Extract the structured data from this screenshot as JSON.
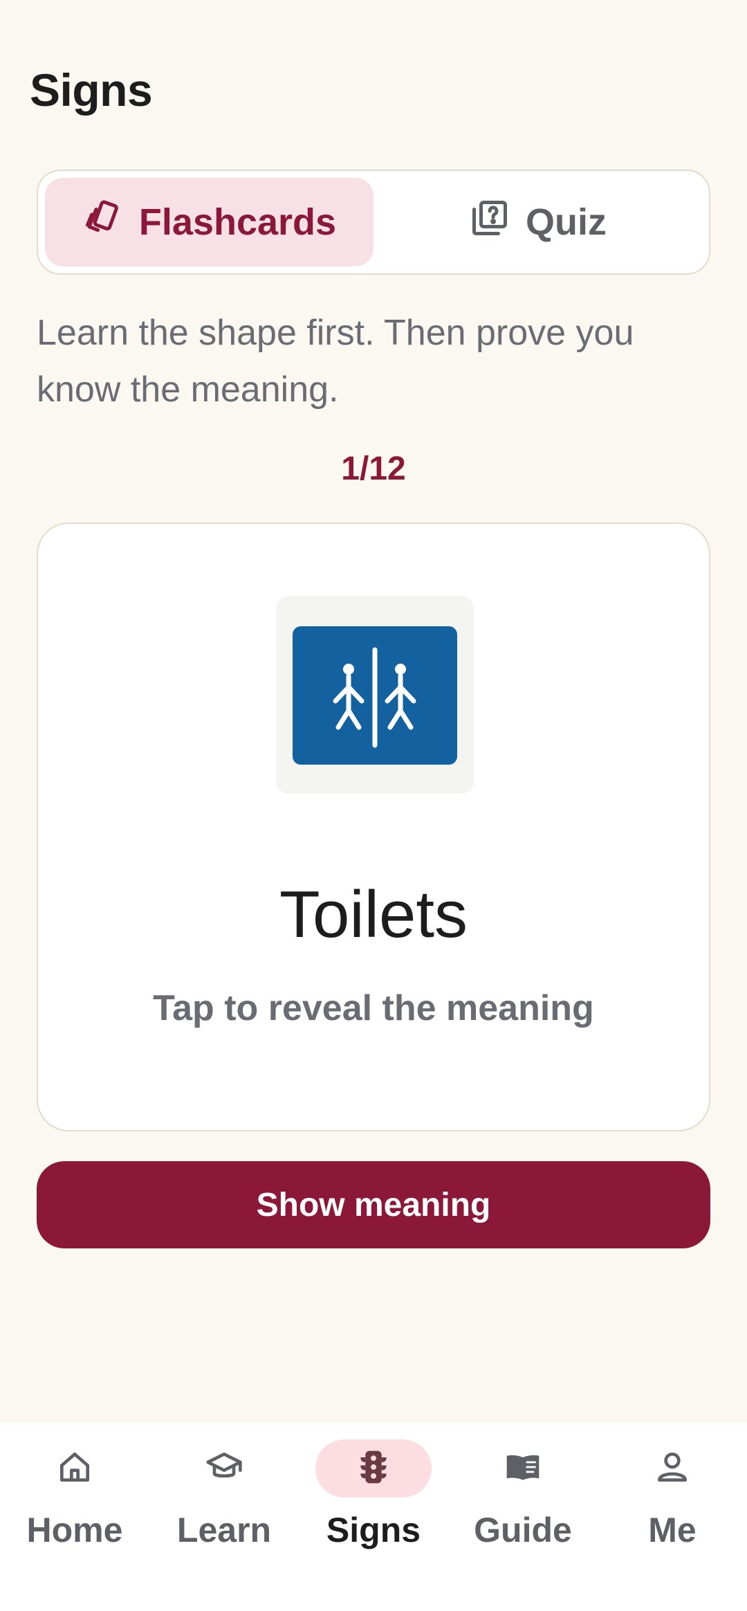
{
  "header": {
    "title": "Signs"
  },
  "mode_tabs": [
    {
      "label": "Flashcards",
      "icon": "cards-icon",
      "active": true
    },
    {
      "label": "Quiz",
      "icon": "quiz-icon",
      "active": false
    }
  ],
  "intro_text": "Learn the shape first. Then prove you know the meaning.",
  "progress": {
    "text": "1/12",
    "current": 1,
    "total": 12
  },
  "card": {
    "sign_icon": "toilets-sign-icon",
    "sign_name": "Toilets",
    "hint": "Tap to reveal the meaning"
  },
  "primary_button": {
    "label": "Show meaning"
  },
  "bottom_nav": [
    {
      "label": "Home",
      "icon": "home-icon",
      "active": false
    },
    {
      "label": "Learn",
      "icon": "graduation-cap-icon",
      "active": false
    },
    {
      "label": "Signs",
      "icon": "traffic-light-icon",
      "active": true
    },
    {
      "label": "Guide",
      "icon": "book-icon",
      "active": false
    },
    {
      "label": "Me",
      "icon": "person-icon",
      "active": false
    }
  ],
  "colors": {
    "accent": "#8b1838",
    "background": "#faf8f1",
    "active_tab_bg": "#f7e1e6",
    "sign_blue": "#1461a0"
  }
}
